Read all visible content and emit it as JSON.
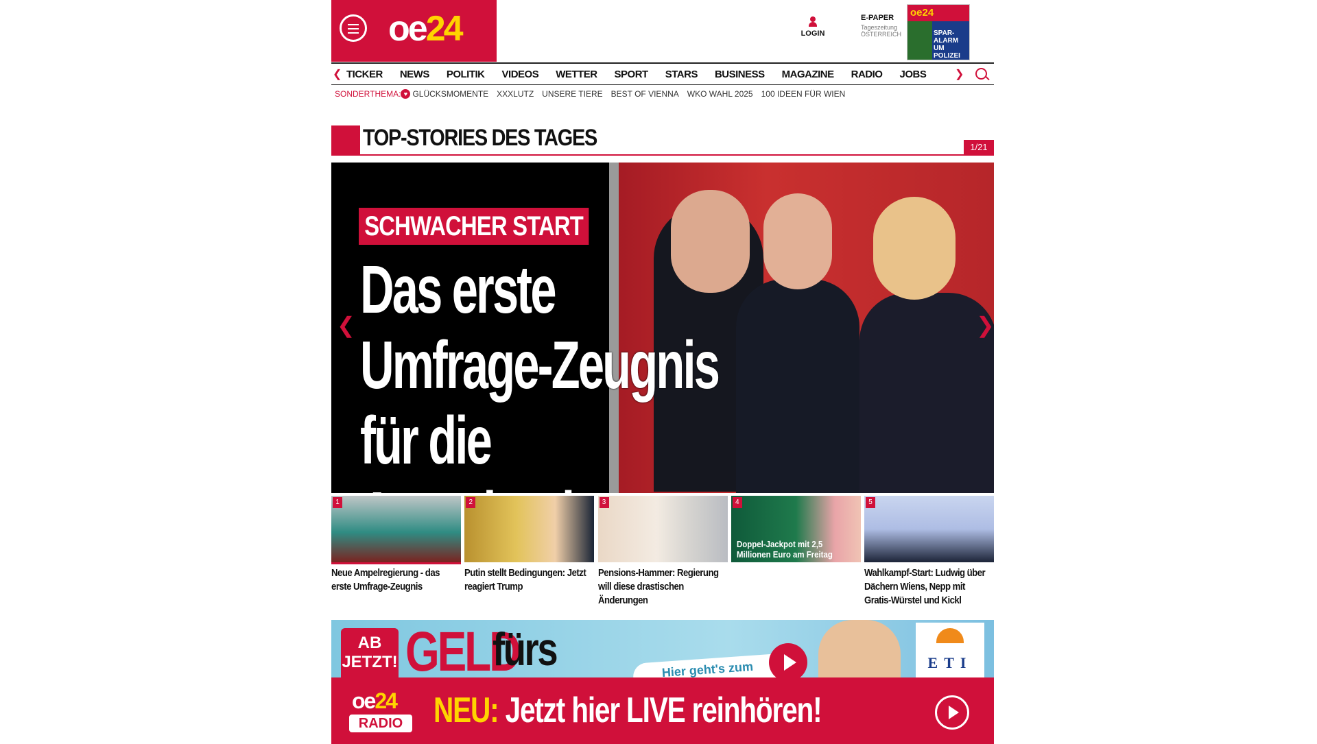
{
  "header": {
    "logo": "oe24",
    "login_label": "LOGIN",
    "epaper": {
      "title": "E-PAPER",
      "line1": "Tageszeitung",
      "line2": "ÖSTERREICH"
    },
    "epaper_cover_text": "SPAR-ALARM UM POLIZEI"
  },
  "nav": {
    "items": [
      "TICKER",
      "NEWS",
      "POLITIK",
      "VIDEOS",
      "WETTER",
      "SPORT",
      "STARS",
      "BUSINESS",
      "MAGAZINE",
      "RADIO",
      "JOBS"
    ]
  },
  "subnav": {
    "label": "SONDERTHEMA:",
    "items": [
      "GLÜCKSMOMENTE",
      "XXXLUTZ",
      "UNSERE TIERE",
      "BEST OF VIENNA",
      "WKO WAHL 2025",
      "100 IDEEN FÜR WIEN"
    ]
  },
  "section": {
    "title": "TOP-STORIES DES TAGES",
    "counter": "1/21"
  },
  "hero": {
    "kicker": "SCHWACHER START",
    "headline_line1": "Das erste",
    "headline_line2": "Umfrage-Zeugnis",
    "headline_line3": "für die Ampelregierung"
  },
  "thumbnails": [
    {
      "num": "1",
      "caption": "Neue Ampelregierung - das erste Umfrage-Zeugnis",
      "overlay": ""
    },
    {
      "num": "2",
      "caption": "Putin stellt Bedingungen: Jetzt reagiert Trump",
      "overlay": ""
    },
    {
      "num": "3",
      "caption": "Pensions-Hammer: Regierung will diese drastischen Änderungen",
      "overlay": ""
    },
    {
      "num": "4",
      "caption": "",
      "overlay": "Doppel-Jackpot mit 2,5 Millionen Euro am Freitag"
    },
    {
      "num": "5",
      "caption": "Wahlkampf-Start: Ludwig über Dächern Wiens, Nepp mit Gratis-Würstel und Kickl",
      "overlay": ""
    }
  ],
  "banner": {
    "ab_jetzt": "AB JETZT!",
    "geld": "GELD",
    "furs": "fürs",
    "pill": "Hier geht's zum",
    "eti": "ETI"
  },
  "radio": {
    "logo": "oe24",
    "logo_sub": "RADIO",
    "neu": "NEU:",
    "text": "Jetzt hier LIVE reinhören!"
  },
  "colors": {
    "brand": "#d0103a",
    "accent": "#ffd400"
  }
}
